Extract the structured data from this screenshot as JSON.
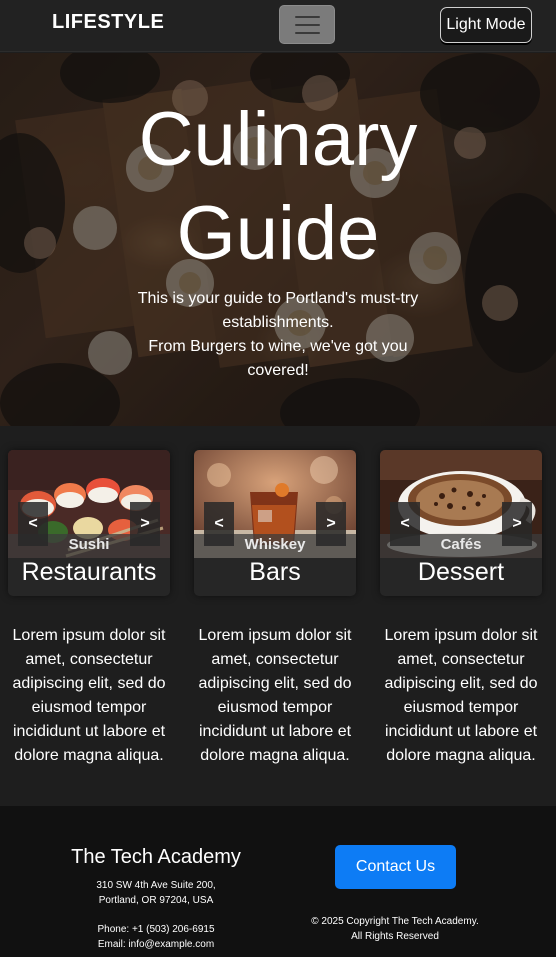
{
  "navbar": {
    "brand": "LIFESTYLE",
    "toggle_icon": "hamburger-icon",
    "mode_button": "Light Mode"
  },
  "hero": {
    "title_line1": "Culinary",
    "title_line2": "Guide",
    "subtitle_line1": "This is your guide to Portland's must-try establishments.",
    "subtitle_line2": "From Burgers to wine, we've got you covered!"
  },
  "cards": [
    {
      "caption": "Sushi",
      "title": "Restaurants",
      "prev": "<",
      "next": ">",
      "text": "Lorem ipsum dolor sit amet, consectetur adipiscing elit, sed do eiusmod tempor incididunt ut labore et dolore magna aliqua."
    },
    {
      "caption": "Whiskey",
      "title": "Bars",
      "prev": "<",
      "next": ">",
      "text": "Lorem ipsum dolor sit amet, consectetur adipiscing elit, sed do eiusmod tempor incididunt ut labore et dolore magna aliqua."
    },
    {
      "caption": "Cafés",
      "title": "Dessert",
      "prev": "<",
      "next": ">",
      "text": "Lorem ipsum dolor sit amet, consectetur adipiscing elit, sed do eiusmod tempor incididunt ut labore et dolore magna aliqua."
    }
  ],
  "footer": {
    "org_name": "The Tech Academy",
    "address_line1": "310 SW 4th Ave Suite 200,",
    "address_line2": "Portland, OR 97204, USA",
    "phone": "Phone: +1 (503) 206-6915",
    "email": "Email: info@example.com",
    "contact_button": "Contact Us",
    "copyright": "© 2025 Copyright The Tech Academy.",
    "rights": "All Rights Reserved"
  },
  "colors": {
    "navbar_bg": "#222222",
    "page_bg": "#1e1e1e",
    "footer_bg": "#111111",
    "contact_button_bg": "#0d7cf5"
  }
}
